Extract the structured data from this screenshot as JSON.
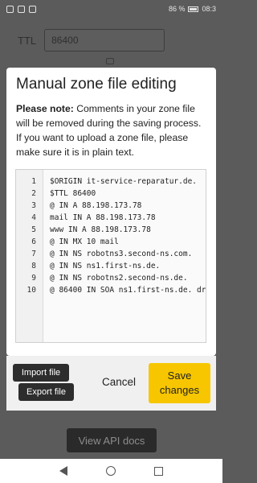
{
  "status": {
    "battery_percent": "86 %",
    "time": "08:3"
  },
  "background": {
    "ttl_label": "TTL",
    "ttl_value": "86400",
    "api_docs_button": "View API docs"
  },
  "modal": {
    "title": "Manual zone file editing",
    "note_bold": "Please note:",
    "note_text": " Comments in your zone file will be removed during the saving process. If you want to upload a zone file, please make sure it is in plain text.",
    "lines": [
      {
        "n": "1",
        "text": "$ORIGIN it-service-reparatur.de."
      },
      {
        "n": "2",
        "text": "$TTL 86400"
      },
      {
        "n": "3",
        "text": "@ IN A 88.198.173.78"
      },
      {
        "n": "4",
        "text": "mail IN A 88.198.173.78"
      },
      {
        "n": "5",
        "text": "www IN A 88.198.173.78"
      },
      {
        "n": "6",
        "text": "@ IN MX 10 mail"
      },
      {
        "n": "7",
        "text": "@ IN NS robotns3.second-ns.com."
      },
      {
        "n": "8",
        "text": "@ IN NS ns1.first-ns.de."
      },
      {
        "n": "9",
        "text": "@ IN NS robotns2.second-ns.de."
      },
      {
        "n": "10",
        "text": "@ 86400 IN SOA ns1.first-ns.de. dr"
      }
    ],
    "import_button": "Import file",
    "export_button": "Export file",
    "cancel_button": "Cancel",
    "save_button": "Save changes"
  },
  "colors": {
    "accent": "#f7c600",
    "dark_button": "#2d2d2d"
  }
}
